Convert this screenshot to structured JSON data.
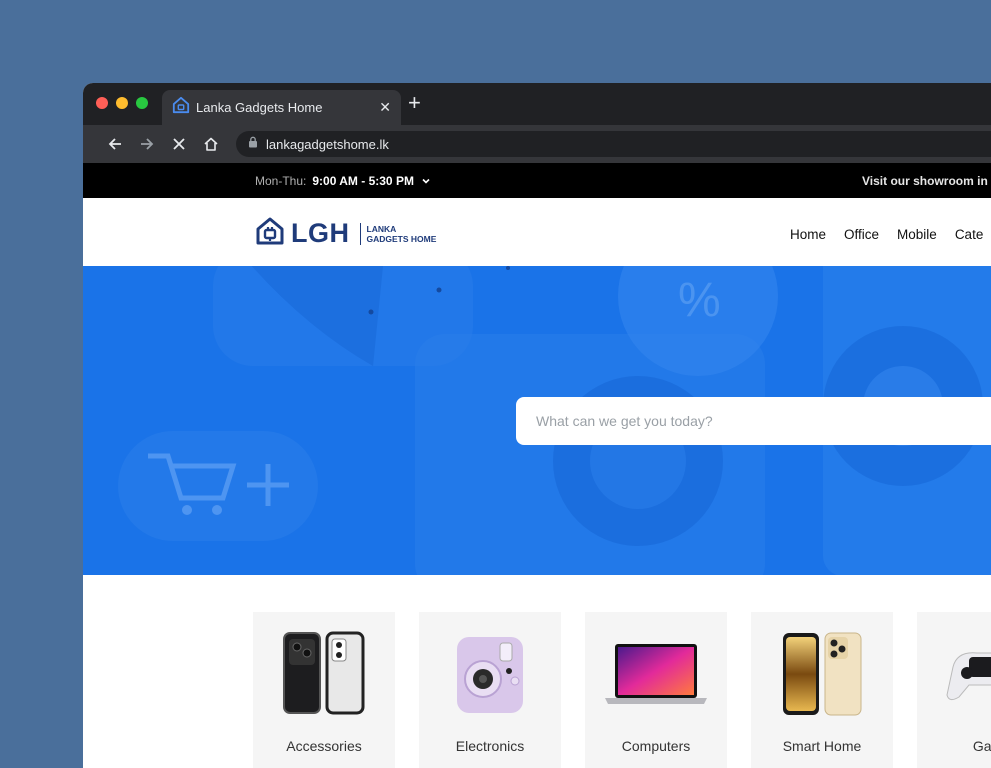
{
  "browser": {
    "tab_title": "Lanka Gadgets Home",
    "url": "lankagadgetshome.lk"
  },
  "topbar": {
    "hours_label": "Mon-Thu:",
    "hours_value": "9:00 AM - 5:30 PM",
    "showroom_text": "Visit our showroom in"
  },
  "header": {
    "logo_text": "LGH",
    "logo_sub_line1": "LANKA",
    "logo_sub_line2": "GADGETS HOME",
    "nav": [
      "Home",
      "Office",
      "Mobile",
      "Cate"
    ]
  },
  "hero": {
    "search_placeholder": "What can we get you today?"
  },
  "categories": [
    "Accessories",
    "Electronics",
    "Computers",
    "Smart Home",
    "Gam"
  ]
}
